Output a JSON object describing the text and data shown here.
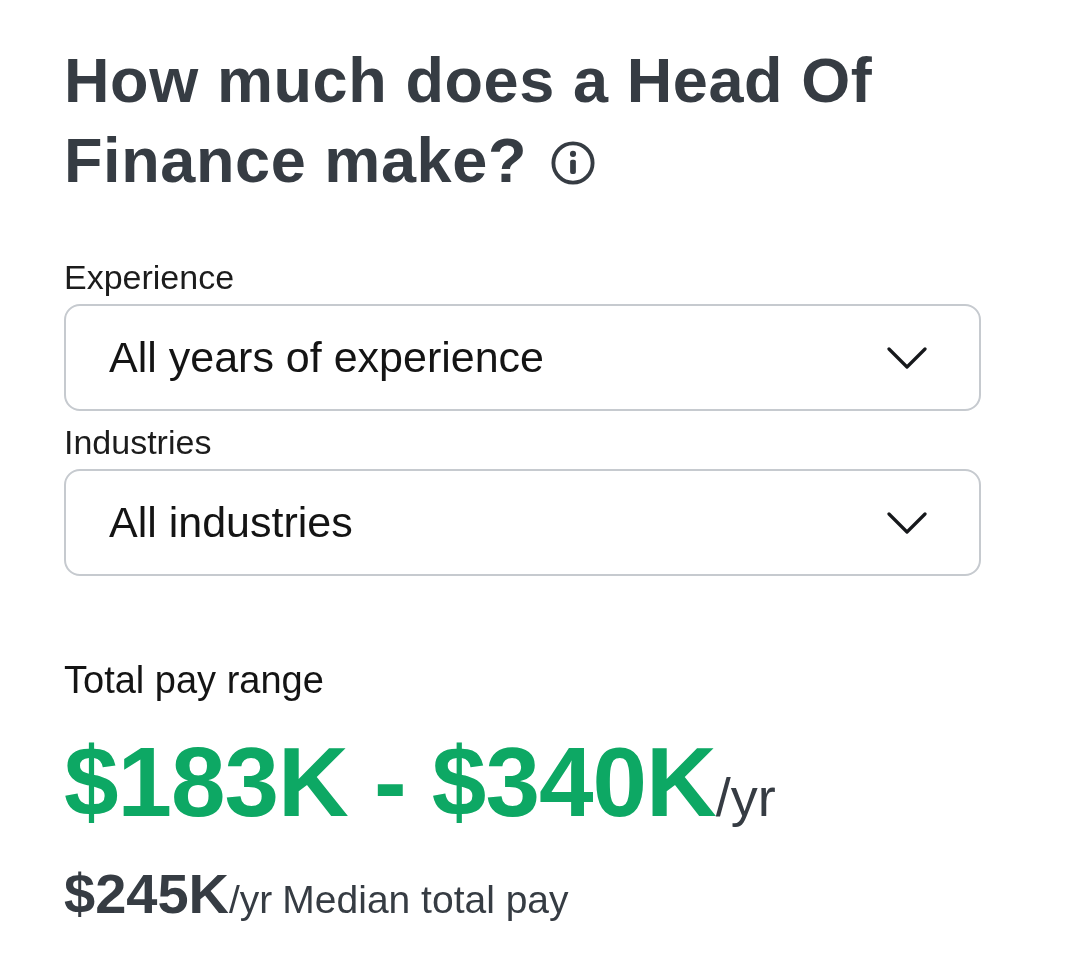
{
  "title": {
    "lines": [
      "How much does a Head Of",
      "Finance make?"
    ]
  },
  "filters": [
    {
      "label": "Experience",
      "value": "All years of experience"
    },
    {
      "label": "Industries",
      "value": "All industries"
    }
  ],
  "pay": {
    "label": "Total pay range",
    "range": "$183K - $340K",
    "range_unit": "/yr",
    "median": "$245K",
    "median_unit": "/yr",
    "median_label": "Median total pay"
  }
}
